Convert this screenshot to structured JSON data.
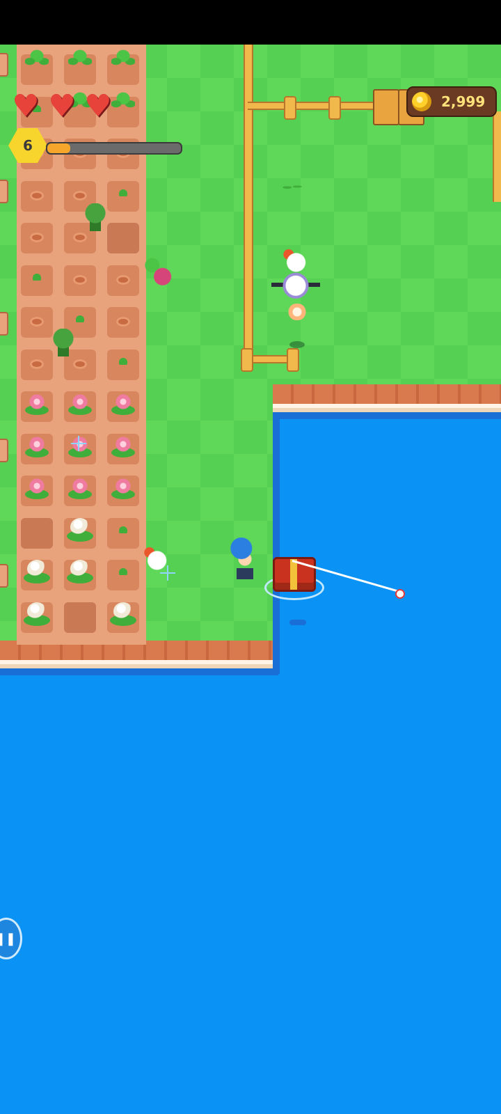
{
  "hud": {
    "hearts": [
      "♥",
      "♥",
      "♥"
    ],
    "level": "6",
    "xp_progress": 0.17,
    "coins": "2,999",
    "coin_icon": "coin-icon",
    "heart_icon": "heart-icon"
  },
  "chat_button": {
    "glyph": "❚❚",
    "icon": "chat-bubble-icon"
  },
  "colors": {
    "grass": "#5fd85a",
    "water": "#0a93f5",
    "soil": "#e8a27c",
    "cliff": "#d87a4e",
    "fence": "#f1b84c",
    "coin_panel": "#6a3a22",
    "coin_text": "#ffe27a",
    "heart": "#e8433a",
    "level_badge": "#f7d52c",
    "xp_fill": "#f6a62a"
  },
  "field": {
    "rows": [
      [
        "leafy",
        "leafy",
        "leafy"
      ],
      [
        "sprout",
        "leafy",
        "leafy"
      ],
      [
        "seed",
        "seed",
        "seed"
      ],
      [
        "seed",
        "seed",
        "sprout"
      ],
      [
        "seed",
        "seed",
        "empty"
      ],
      [
        "sprout",
        "seed",
        "seed"
      ],
      [
        "seed",
        "sprout",
        "seed"
      ],
      [
        "seed",
        "seed",
        "sprout"
      ],
      [
        "flower",
        "flower",
        "flower"
      ],
      [
        "flower",
        "flower",
        "flower"
      ],
      [
        "flower",
        "flower",
        "flower"
      ],
      [
        "empty",
        "cauli",
        "sprout"
      ],
      [
        "cauli",
        "cauli",
        "sprout"
      ],
      [
        "cauli",
        "empty",
        "cauli"
      ]
    ]
  }
}
